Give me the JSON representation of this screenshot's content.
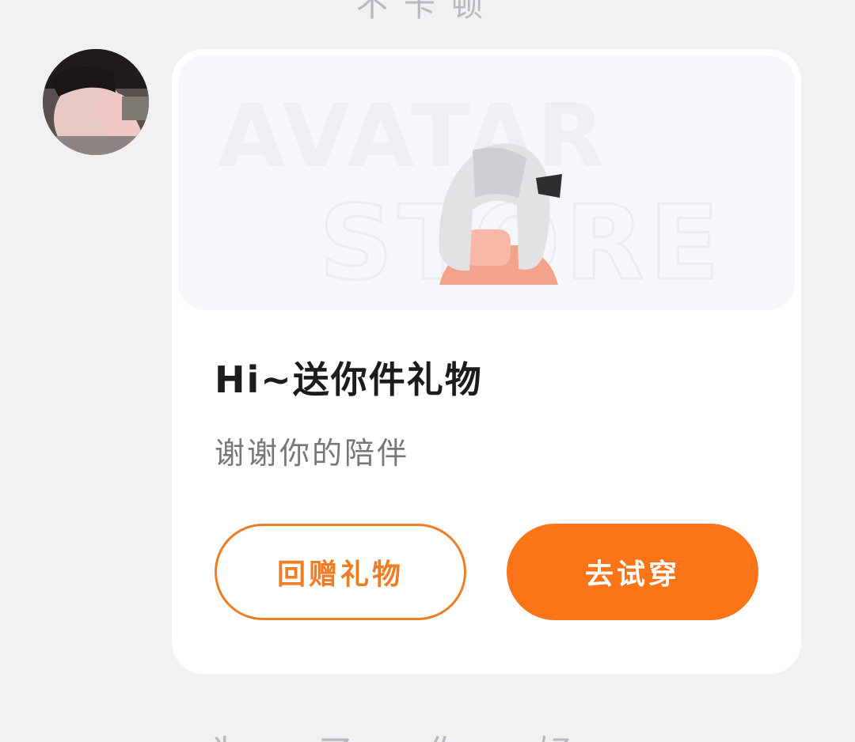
{
  "header": {
    "partial_text": "不卡顿"
  },
  "footer": {
    "partial_text": "一一 为 了 你 好 一 一"
  },
  "sender": {
    "avatar_icon": "user-photo"
  },
  "gift_card": {
    "banner": {
      "line1": "AVATAR",
      "line2": "STORE",
      "item_icon": "avatar-hair-item"
    },
    "title": "Hi~送你件礼物",
    "subtitle": "谢谢你的陪伴",
    "return_gift_label": "回赠礼物",
    "try_on_label": "去试穿"
  },
  "colors": {
    "accent": "#fb7418",
    "outline": "#ef7d25",
    "background": "#f1f1f3",
    "card": "#ffffff"
  }
}
